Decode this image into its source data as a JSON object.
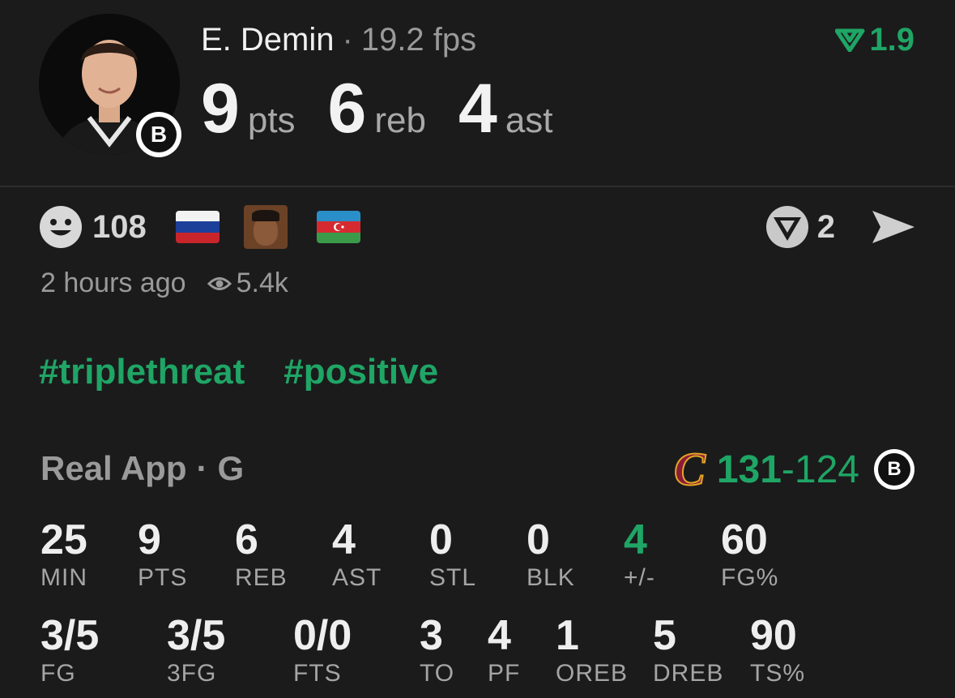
{
  "player": {
    "name": "E. Demin",
    "fps": "19.2 fps",
    "rating": "1.9",
    "stats": [
      {
        "value": "9",
        "unit": "pts"
      },
      {
        "value": "6",
        "unit": "reb"
      },
      {
        "value": "4",
        "unit": "ast"
      }
    ],
    "team_badge_letter": "B"
  },
  "social": {
    "reaction_count": "108",
    "share_count": "2",
    "time_ago": "2 hours ago",
    "views": "5.4k"
  },
  "tags": [
    "#triplethreat",
    "#positive"
  ],
  "game": {
    "league": "Real App",
    "position": "G",
    "home_logo_letter": "C",
    "home_score": "131",
    "separator": "-",
    "away_score": "124",
    "away_badge_letter": "B"
  },
  "box_row1": [
    {
      "value": "25",
      "label": "MIN"
    },
    {
      "value": "9",
      "label": "PTS"
    },
    {
      "value": "6",
      "label": "REB"
    },
    {
      "value": "4",
      "label": "AST"
    },
    {
      "value": "0",
      "label": "STL"
    },
    {
      "value": "0",
      "label": "BLK"
    },
    {
      "value": "4",
      "label": "+/-"
    },
    {
      "value": "60",
      "label": "FG%"
    }
  ],
  "box_row2": [
    {
      "value": "3/5",
      "label": "FG"
    },
    {
      "value": "3/5",
      "label": "3FG"
    },
    {
      "value": "0/0",
      "label": "FTS"
    },
    {
      "value": "3",
      "label": "TO"
    },
    {
      "value": "4",
      "label": "PF"
    },
    {
      "value": "1",
      "label": "OREB"
    },
    {
      "value": "5",
      "label": "DREB"
    },
    {
      "value": "90",
      "label": "TS%"
    }
  ],
  "colors": {
    "background": "#1b1b1c",
    "accent_green": "#1fa565",
    "muted_text": "#9a9a9a"
  }
}
